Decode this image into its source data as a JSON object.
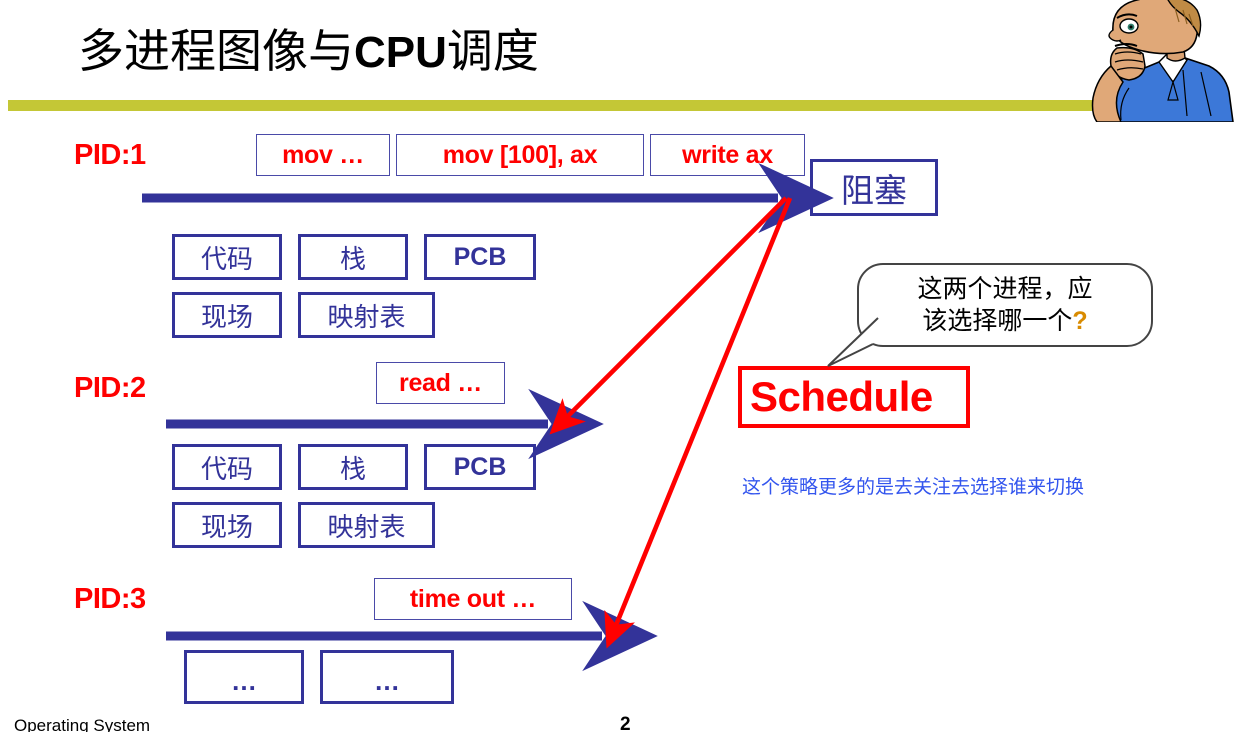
{
  "slide": {
    "title_cjk_1": "多进程图像与",
    "title_latin": "CPU",
    "title_cjk_2": "调度",
    "rule_color": "#C4C736"
  },
  "processes": [
    {
      "pid_label": "PID:1",
      "instructions": [
        "mov …",
        "mov [100], ax",
        "write ax"
      ],
      "resources_row1": [
        "代码",
        "栈",
        "PCB"
      ],
      "resources_row2": [
        "现场",
        "映射表"
      ]
    },
    {
      "pid_label": "PID:2",
      "instructions": [
        "read …"
      ],
      "resources_row1": [
        "代码",
        "栈",
        "PCB"
      ],
      "resources_row2": [
        "现场",
        "映射表"
      ]
    },
    {
      "pid_label": "PID:3",
      "instructions": [
        "time out …"
      ],
      "resources_row1": [
        "…",
        "…"
      ],
      "resources_row2": []
    }
  ],
  "blocked": {
    "label": "阻塞"
  },
  "schedule": {
    "label": "Schedule",
    "color": "#FF0000"
  },
  "bubble": {
    "line1": "这两个进程，应",
    "line2_text": "该选择哪一个",
    "line2_qmark": "?"
  },
  "note": {
    "text": "这个策略更多的是去关注去选择谁来切换",
    "color": "#3355EE"
  },
  "footer": {
    "left": "Operating System",
    "page": "2"
  },
  "colors": {
    "timeline_blue": "#333399",
    "instruction_red": "#FF0000",
    "rule_olive": "#C4C736"
  }
}
